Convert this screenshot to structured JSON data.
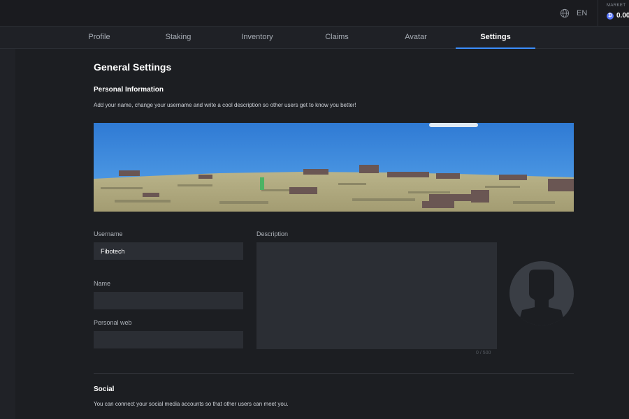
{
  "topbar": {
    "language": "EN",
    "wallet_label": "MARKET",
    "wallet_value": "0.00",
    "coin_symbol": "₿"
  },
  "tabs": [
    {
      "label": "Profile"
    },
    {
      "label": "Staking"
    },
    {
      "label": "Inventory"
    },
    {
      "label": "Claims"
    },
    {
      "label": "Avatar"
    },
    {
      "label": "Settings",
      "active": true
    }
  ],
  "page": {
    "title": "General Settings",
    "personal": {
      "heading": "Personal Information",
      "description": "Add your name, change your username and write a cool description so other users get to know you better!"
    },
    "form": {
      "username_label": "Username",
      "username_value": "Fibotech",
      "name_label": "Name",
      "name_value": "",
      "web_label": "Personal web",
      "web_value": "",
      "description_label": "Description",
      "description_value": "",
      "counter": "0 / 500"
    },
    "social": {
      "heading": "Social",
      "description": "You can connect your social media accounts so that other users can meet you."
    }
  },
  "colors": {
    "accent": "#3b8dff",
    "background": "#1c1e22",
    "field": "#2b2e34"
  }
}
